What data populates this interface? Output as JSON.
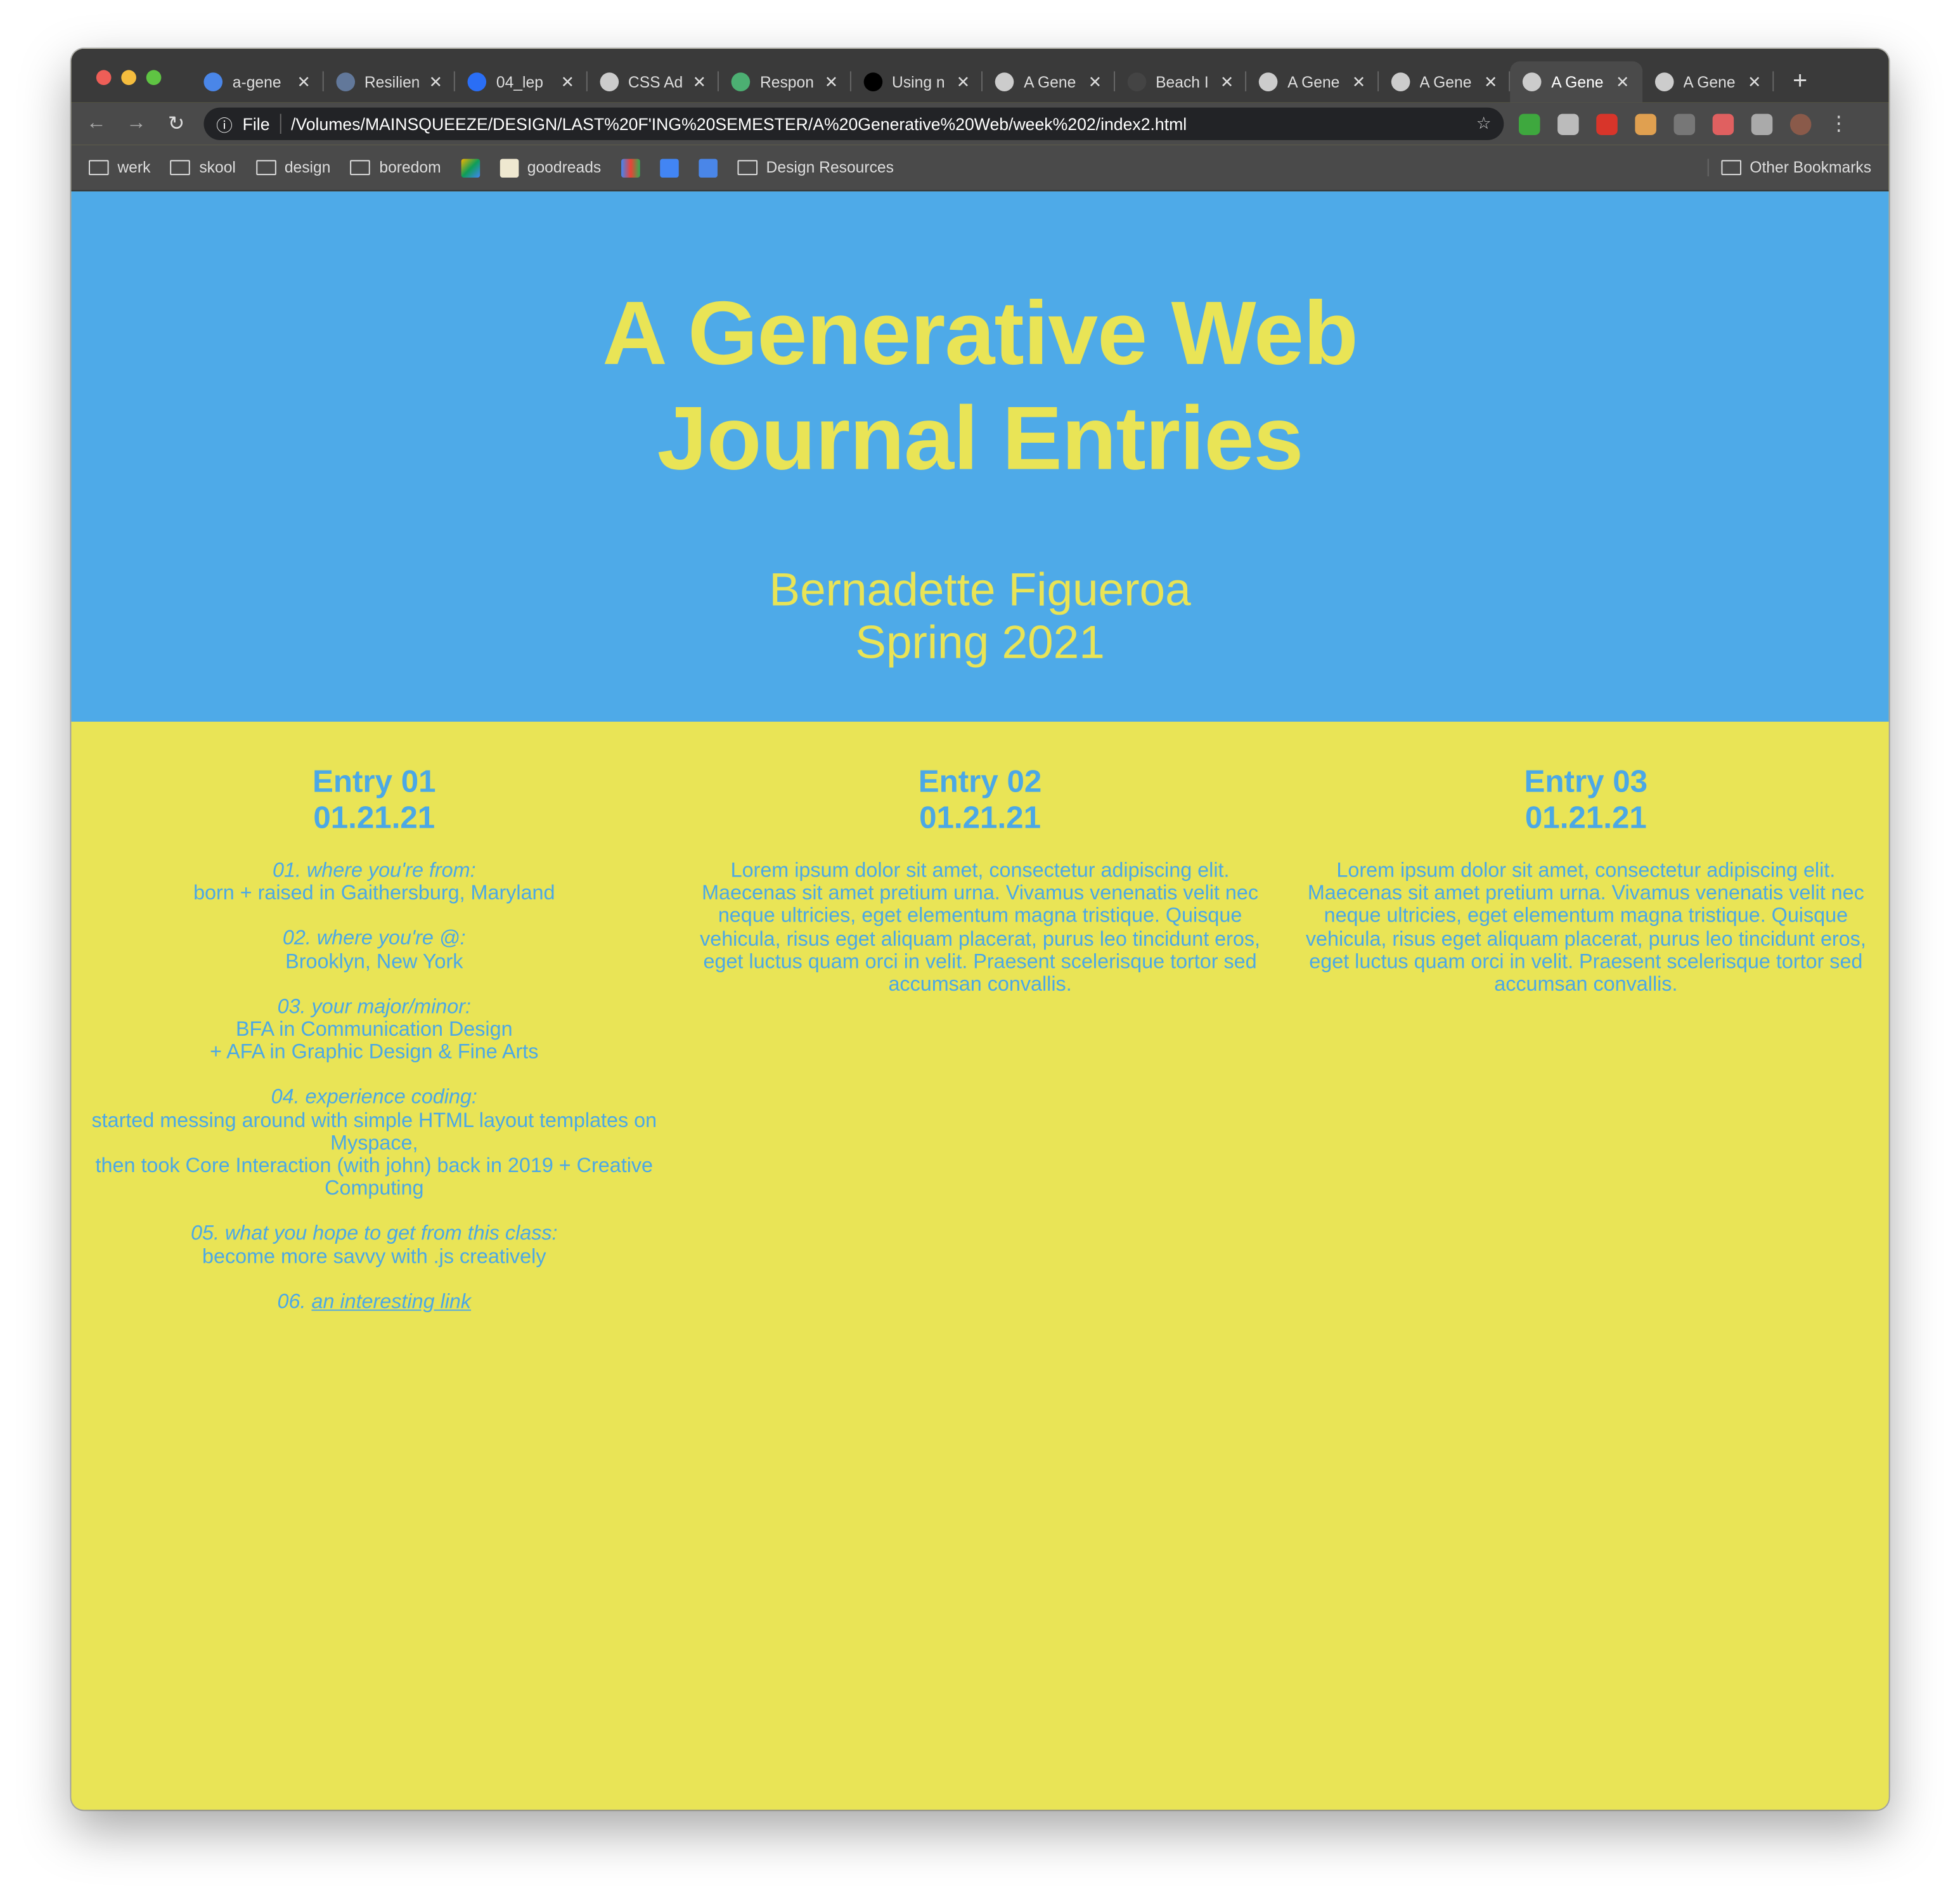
{
  "browser": {
    "tabs": [
      {
        "title": "a-gene",
        "icon": "google-docs-icon",
        "color": "#4a86e8"
      },
      {
        "title": "Resilien",
        "icon": "page-icon",
        "color": "#62789a"
      },
      {
        "title": "04_lep",
        "icon": "dropbox-icon",
        "color": "#2a6ef5"
      },
      {
        "title": "CSS Ad",
        "icon": "globe-icon",
        "color": "#ccc"
      },
      {
        "title": "Respon",
        "icon": "w3schools-icon",
        "color": "#4caf72"
      },
      {
        "title": "Using n",
        "icon": "bird-icon",
        "color": "#000"
      },
      {
        "title": "A Gene",
        "icon": "globe-icon",
        "color": "#ccc"
      },
      {
        "title": "Beach I",
        "icon": "38-icon",
        "color": "#444"
      },
      {
        "title": "A Gene",
        "icon": "globe-icon",
        "color": "#ccc"
      },
      {
        "title": "A Gene",
        "icon": "globe-icon",
        "color": "#ccc"
      },
      {
        "title": "A Gene",
        "icon": "globe-icon",
        "color": "#ccc",
        "active": true
      },
      {
        "title": "A Gene",
        "icon": "globe-icon",
        "color": "#ccc"
      }
    ],
    "url_scheme": "File",
    "url": "/Volumes/MAINSQUEEZE/DESIGN/LAST%20F'ING%20SEMESTER/A%20Generative%20Web/week%202/index2.html",
    "bookmarks": [
      "werk",
      "skool",
      "design",
      "boredom",
      "goodreads",
      "Design Resources"
    ],
    "other_bookmarks": "Other Bookmarks",
    "extension_colors": [
      "#3ea83e",
      "#bbbbbb",
      "#d8352a",
      "#e0a050",
      "#777777",
      "#e06060",
      "#aaaaaa",
      "#8a5a4a"
    ]
  },
  "page": {
    "title_line1": "A Generative Web",
    "title_line2": "Journal Entries",
    "author": "Bernadette Figueroa",
    "term": "Spring 2021",
    "colors": {
      "blue": "#4eaae8",
      "yellow": "#e9e456"
    },
    "entries": [
      {
        "title": "Entry 01",
        "date": "01.21.21",
        "qa": [
          {
            "q": "01. where you're from:",
            "a": [
              "born + raised in Gaithersburg, Maryland"
            ]
          },
          {
            "q": "02. where you're @:",
            "a": [
              "Brooklyn, New York"
            ]
          },
          {
            "q": "03. your major/minor:",
            "a": [
              "BFA in Communication Design",
              "+ AFA in Graphic Design & Fine Arts"
            ]
          },
          {
            "q": "04. experience coding:",
            "a": [
              "started messing around with simple HTML layout templates on Myspace,",
              "then took Core Interaction (with john) back in 2019 + Creative Computing"
            ]
          },
          {
            "q": "05. what you hope to get from this class:",
            "a": [
              "become more savvy with .js creatively"
            ]
          }
        ],
        "link_prefix": "06.",
        "link_text": "an interesting link"
      },
      {
        "title": "Entry 02",
        "date": "01.21.21",
        "text": "Lorem ipsum dolor sit amet, consectetur adipiscing elit. Maecenas sit amet pretium urna. Vivamus venenatis velit nec neque ultricies, eget elementum magna tristique. Quisque vehicula, risus eget aliquam placerat, purus leo tincidunt eros, eget luctus quam orci in velit. Praesent scelerisque tortor sed accumsan convallis."
      },
      {
        "title": "Entry 03",
        "date": "01.21.21",
        "text": "Lorem ipsum dolor sit amet, consectetur adipiscing elit. Maecenas sit amet pretium urna. Vivamus venenatis velit nec neque ultricies, eget elementum magna tristique. Quisque vehicula, risus eget aliquam placerat, purus leo tincidunt eros, eget luctus quam orci in velit. Praesent scelerisque tortor sed accumsan convallis."
      }
    ]
  }
}
